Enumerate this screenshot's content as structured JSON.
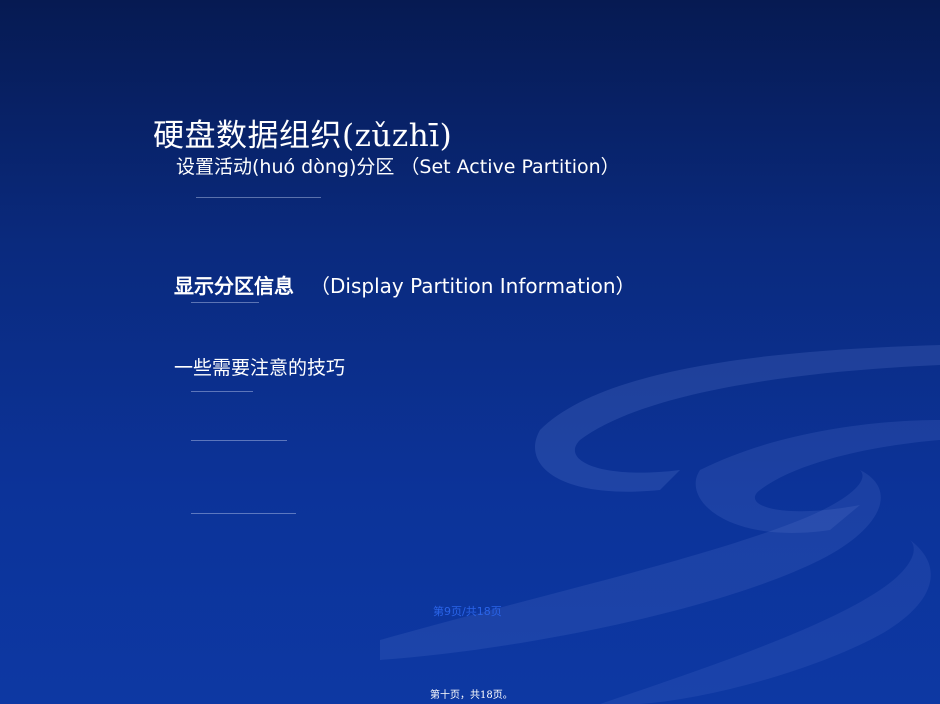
{
  "slide": {
    "title": "硬盘数据组织(zǔzhī)",
    "subtitle": "设置活动(huó dòng)分区 （Set Active Partition）",
    "section_bold": "显示分区信息",
    "section_rest": "（Display Partition Information）",
    "tips": "一些需要注意的技巧",
    "page_marker": "第9页/共18页",
    "footer": "第十页，共18页。"
  },
  "colors": {
    "background_top": "#061a52",
    "background_bottom": "#0d38a3",
    "text": "#ffffff",
    "page_marker": "#2a64e8"
  }
}
